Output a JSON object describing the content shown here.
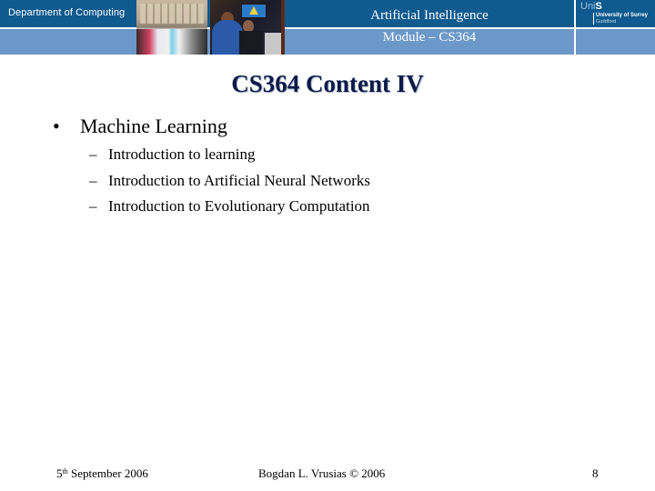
{
  "header": {
    "department": "Department of Computing",
    "course_title": "Artificial Intelligence",
    "module": "Module – CS364",
    "logo": {
      "uni": "Uni",
      "s": "S",
      "university": "University of Surrey",
      "location": "Guildford"
    },
    "photos": [
      "computer-lab-photo",
      "students-at-screen-photo"
    ],
    "colors": {
      "dark_band": "#0f5a8e",
      "light_band": "#6b98c8"
    }
  },
  "slide": {
    "title": "CS364 Content IV",
    "bullets": [
      {
        "symbol": "•",
        "text": "Machine Learning",
        "subitems": [
          {
            "symbol": "–",
            "text": "Introduction to learning"
          },
          {
            "symbol": "–",
            "text": "Introduction to Artificial Neural Networks"
          },
          {
            "symbol": "–",
            "text": "Introduction to Evolutionary Computation"
          }
        ]
      }
    ]
  },
  "footer": {
    "date_day": "5",
    "date_suffix": "th",
    "date_rest": " September 2006",
    "author": "Bogdan L. Vrusias © 2006",
    "page_number": "8"
  }
}
